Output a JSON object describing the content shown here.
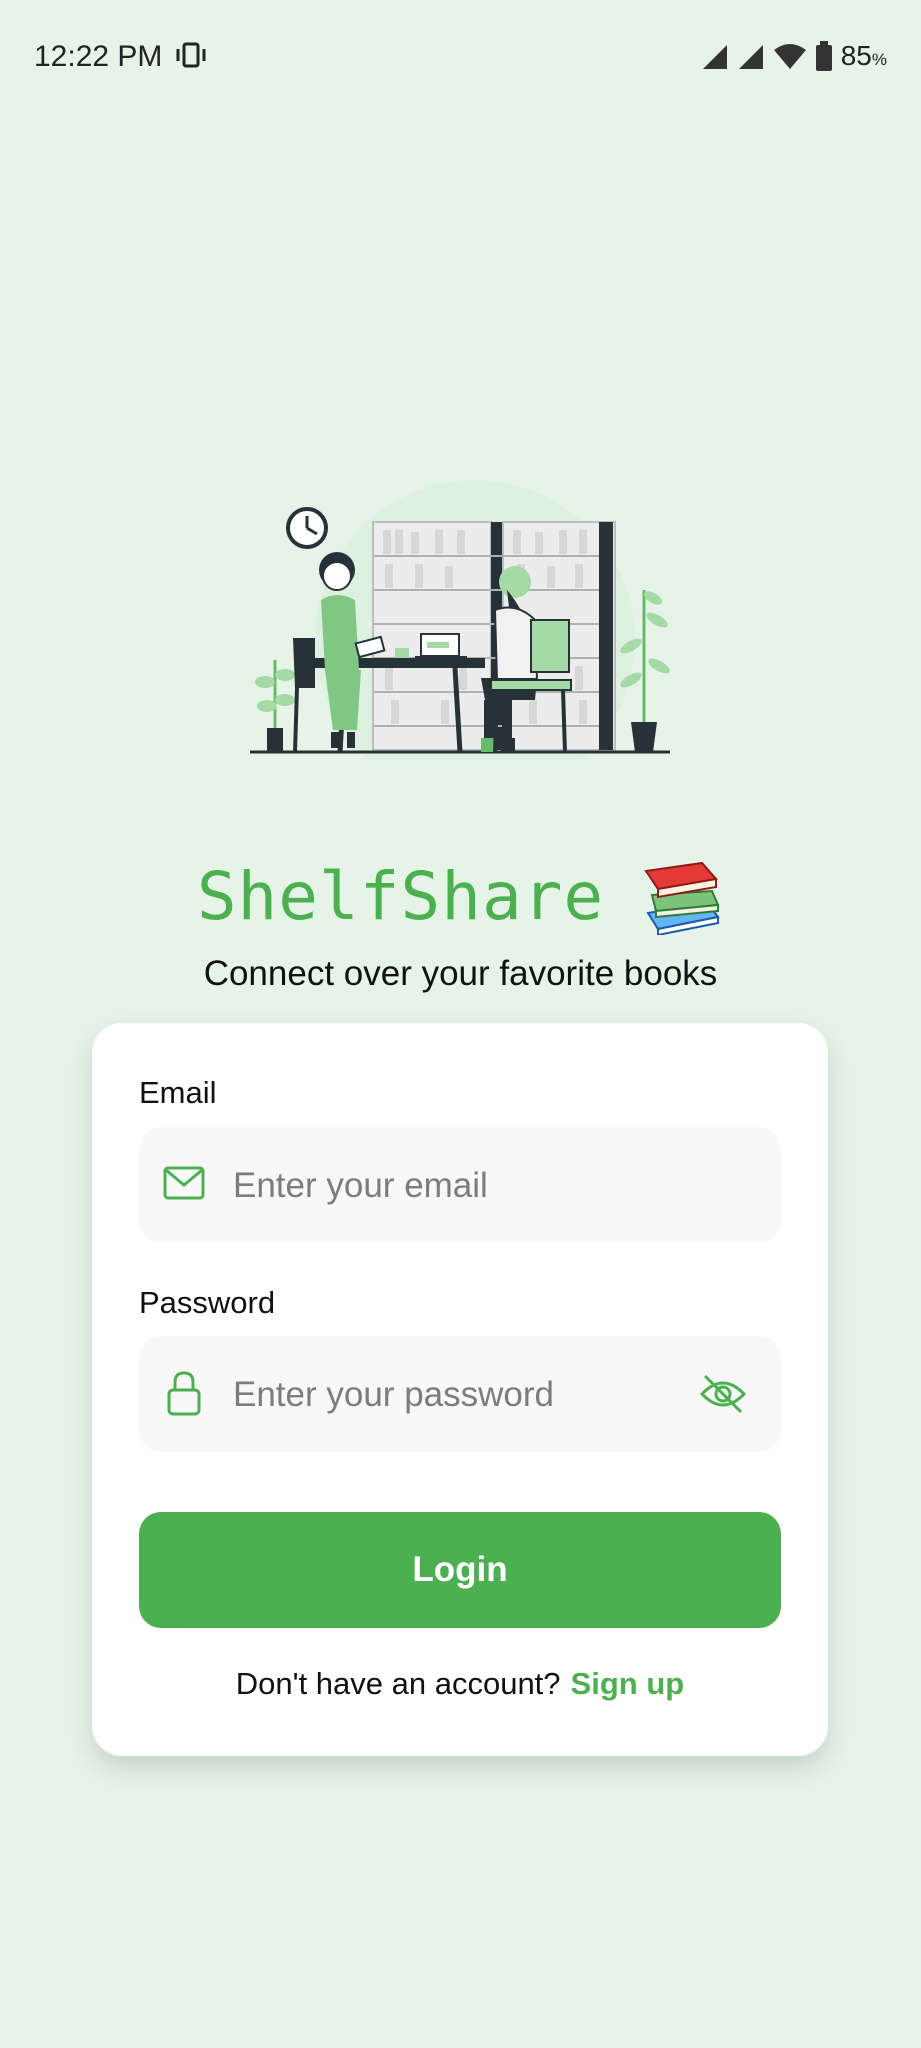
{
  "status_bar": {
    "time": "12:22 PM",
    "battery_percent": "85",
    "battery_unit": "%",
    "icons": [
      "vibrate-icon",
      "signal-icon",
      "signal-icon",
      "wifi-icon",
      "battery-icon"
    ]
  },
  "branding": {
    "app_name": "ShelfShare",
    "emoji_icon": "books-icon",
    "tagline": "Connect over your favorite books"
  },
  "illustration": {
    "icon": "reading-people-illustration",
    "colors": {
      "accent": "#4caf50",
      "accent_light": "#a5d9a5",
      "ink": "#263238"
    }
  },
  "form": {
    "email": {
      "label": "Email",
      "placeholder": "Enter your email",
      "icon": "mail-icon"
    },
    "password": {
      "label": "Password",
      "placeholder": "Enter your password",
      "icon": "lock-icon",
      "toggle_icon": "eye-off-icon"
    },
    "login_label": "Login",
    "signup_prompt": "Don't have an account?",
    "signup_link": "Sign up"
  },
  "colors": {
    "background": "#e6f4e8",
    "brand": "#4caf50",
    "card": "#ffffff",
    "input_bg": "#f8f8f8"
  }
}
